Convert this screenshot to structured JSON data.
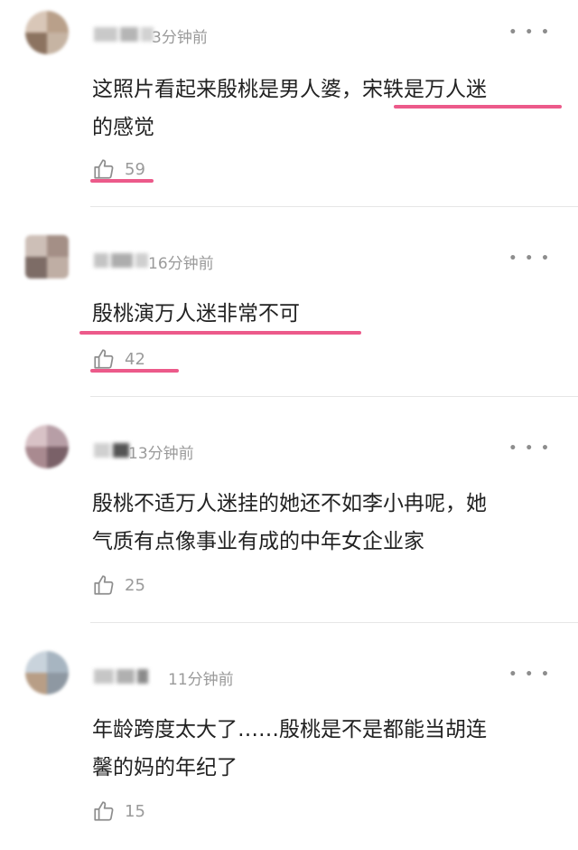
{
  "accent_color": "#ec5a8a",
  "more_icon": "more-dots-icon",
  "like_icon": "thumbs-up-icon",
  "comments": [
    {
      "time": "3分钟前",
      "text_parts": [
        "这照片看起来殷桃是男人婆，",
        "宋轶是万人迷"
      ],
      "text_line2": "的感觉",
      "likes": "59"
    },
    {
      "time": "16分钟前",
      "text": "殷桃演万人迷非常不可",
      "likes": "42"
    },
    {
      "time": "13分钟前",
      "text_line1": "殷桃不适万人迷挂的她还不如李小冉呢，她",
      "text_line2": "气质有点像事业有成的中年女企业家",
      "likes": "25"
    },
    {
      "time": "11分钟前",
      "text_line1": "年龄跨度太大了……殷桃是不是都能当胡连",
      "text_line2": "馨的妈的年纪了",
      "likes": "15"
    }
  ]
}
